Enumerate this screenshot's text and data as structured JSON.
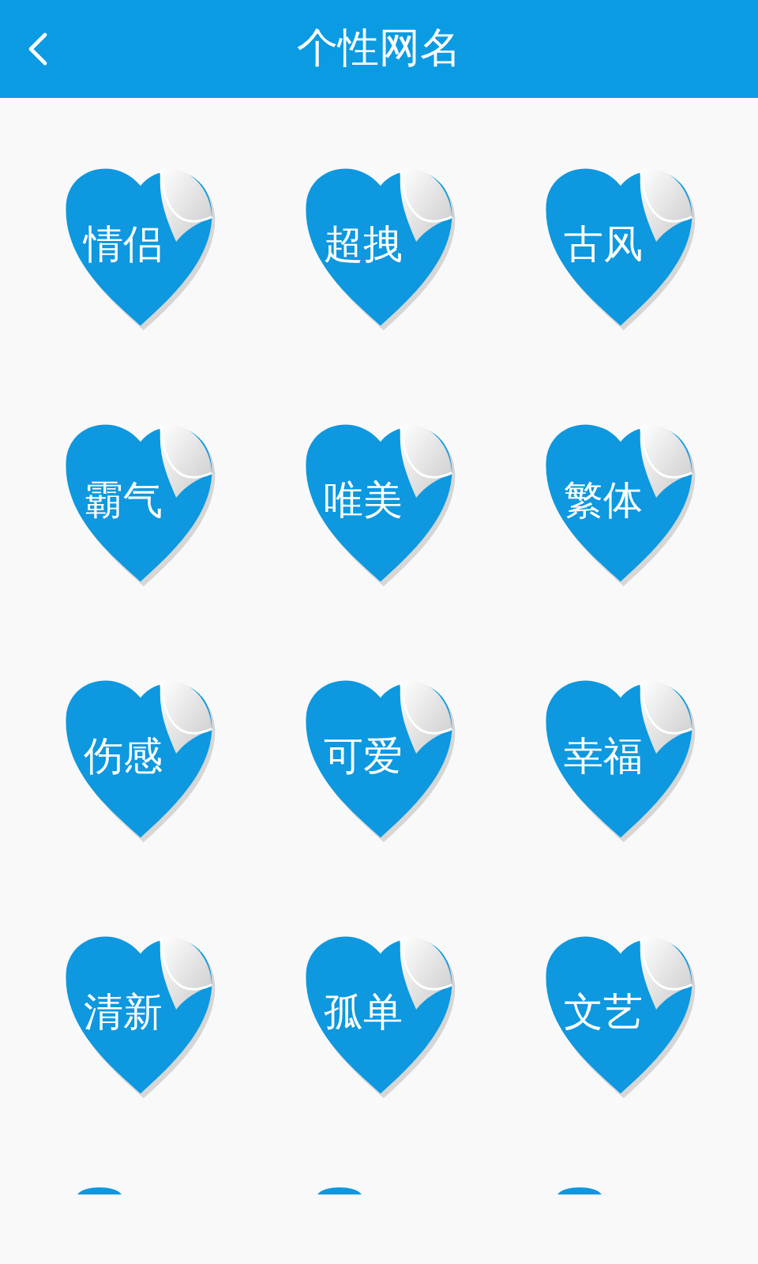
{
  "header": {
    "title": "个性网名"
  },
  "categories": [
    {
      "kind": "heart",
      "label": "情侣"
    },
    {
      "kind": "heart",
      "label": "超拽"
    },
    {
      "kind": "heart",
      "label": "古风"
    },
    {
      "kind": "heart",
      "label": "霸气"
    },
    {
      "kind": "heart",
      "label": "唯美"
    },
    {
      "kind": "heart",
      "label": "繁体"
    },
    {
      "kind": "heart",
      "label": "伤感"
    },
    {
      "kind": "heart",
      "label": "可爱"
    },
    {
      "kind": "heart",
      "label": "幸福"
    },
    {
      "kind": "heart",
      "label": "清新"
    },
    {
      "kind": "heart",
      "label": "孤单"
    },
    {
      "kind": "heart",
      "label": "文艺"
    },
    {
      "kind": "cut_off"
    },
    {
      "kind": "cut_off"
    },
    {
      "kind": "cut_off"
    }
  ]
}
